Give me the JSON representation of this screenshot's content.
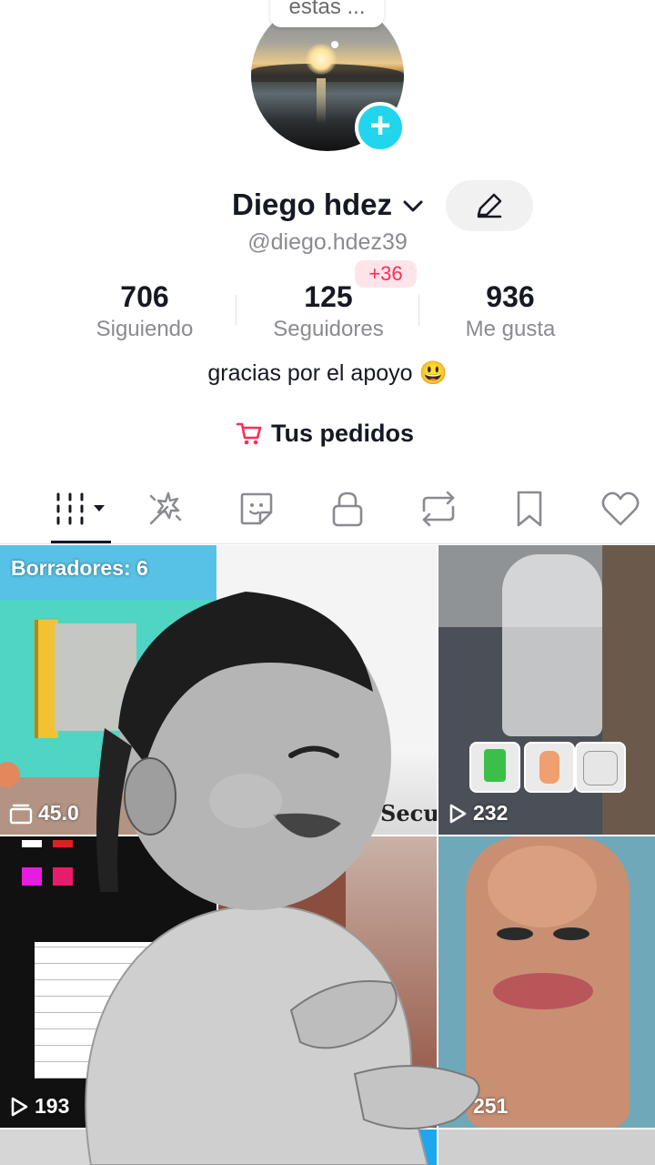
{
  "avatar": {
    "bubble_text": "estas ...",
    "add_symbol": "+"
  },
  "profile": {
    "name": "Diego hdez",
    "handle": "@diego.hdez39",
    "bio": "gracias por el apoyo 😃"
  },
  "stats": {
    "following": {
      "value": "706",
      "label": "Siguiendo"
    },
    "followers": {
      "value": "125",
      "label": "Seguidores",
      "badge": "+36"
    },
    "likes": {
      "value": "936",
      "label": "Me gusta"
    }
  },
  "orders": {
    "label": "Tus pedidos",
    "icon": "cart-icon"
  },
  "tabs": [
    {
      "name": "videos",
      "icon": "grid-icon",
      "active": true
    },
    {
      "name": "sparkle",
      "icon": "sparkle-icon"
    },
    {
      "name": "stickers",
      "icon": "sticker-icon"
    },
    {
      "name": "private",
      "icon": "lock-icon"
    },
    {
      "name": "reposts",
      "icon": "repost-icon"
    },
    {
      "name": "saved",
      "icon": "bookmark-icon"
    },
    {
      "name": "liked",
      "icon": "heart-icon"
    }
  ],
  "grid": {
    "drafts_label": "Borradores: 6",
    "drafts_views": "45.0",
    "cell2_caption": "Secu",
    "cell3_views": "232",
    "cell4_views": "193",
    "cell6_views": "251"
  },
  "colors": {
    "accent": "#fe2c55",
    "add_button": "#20d5ec"
  }
}
